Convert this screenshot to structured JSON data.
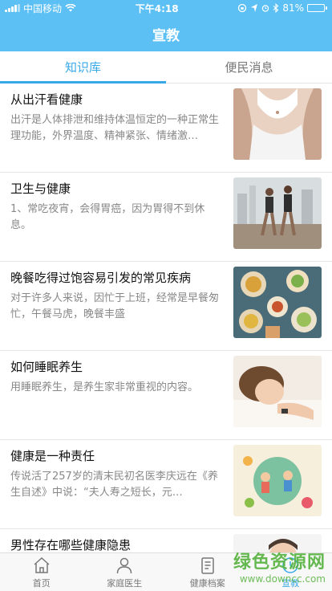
{
  "status": {
    "carrier": "中国移动",
    "time": "下午4:18",
    "battery": "81%",
    "battery_level": 0.81
  },
  "header": {
    "title": "宣教"
  },
  "tabs": [
    {
      "label": "知识库"
    },
    {
      "label": "便民消息"
    }
  ],
  "articles": [
    {
      "title": "从出汗看健康",
      "desc": "出汗是人体排泄和维持体温恒定的一种正常生理功能，外界温度、精神紧张、情绪激…",
      "image": "sweat-back-photo"
    },
    {
      "title": "卫生与健康",
      "desc": "1、常吃夜宵，会得胃癌，因为胃得不到休息。",
      "image": "runners-photo"
    },
    {
      "title": "晚餐吃得过饱容易引发的常见疾病",
      "desc": "对于许多人来说，因忙于上班，经常是早餐匆忙，午餐马虎，晚餐丰盛",
      "image": "food-table-photo"
    },
    {
      "title": "如何睡眠养生",
      "desc": "用睡眠养生，是养生家非常重视的内容。",
      "image": "sleeping-woman-photo"
    },
    {
      "title": "健康是一种责任",
      "desc": "传说活了257岁的清末民初名医李庆远在《养生自述》中说：“夫人寿之短长，元…",
      "image": "health-illustration"
    },
    {
      "title": "男性存在哪些健康隐患",
      "desc": "",
      "image": "man-photo"
    }
  ],
  "tabbar": [
    {
      "label": "首页",
      "icon": "home-icon"
    },
    {
      "label": "家庭医生",
      "icon": "doctor-icon"
    },
    {
      "label": "健康档案",
      "icon": "record-icon"
    },
    {
      "label": "宣教",
      "icon": "education-icon"
    }
  ],
  "watermark": {
    "line1": "绿色资源网",
    "line2": "www.downcc.com"
  },
  "colors": {
    "accent": "#38a8e8",
    "header": "#5cc0f5"
  }
}
